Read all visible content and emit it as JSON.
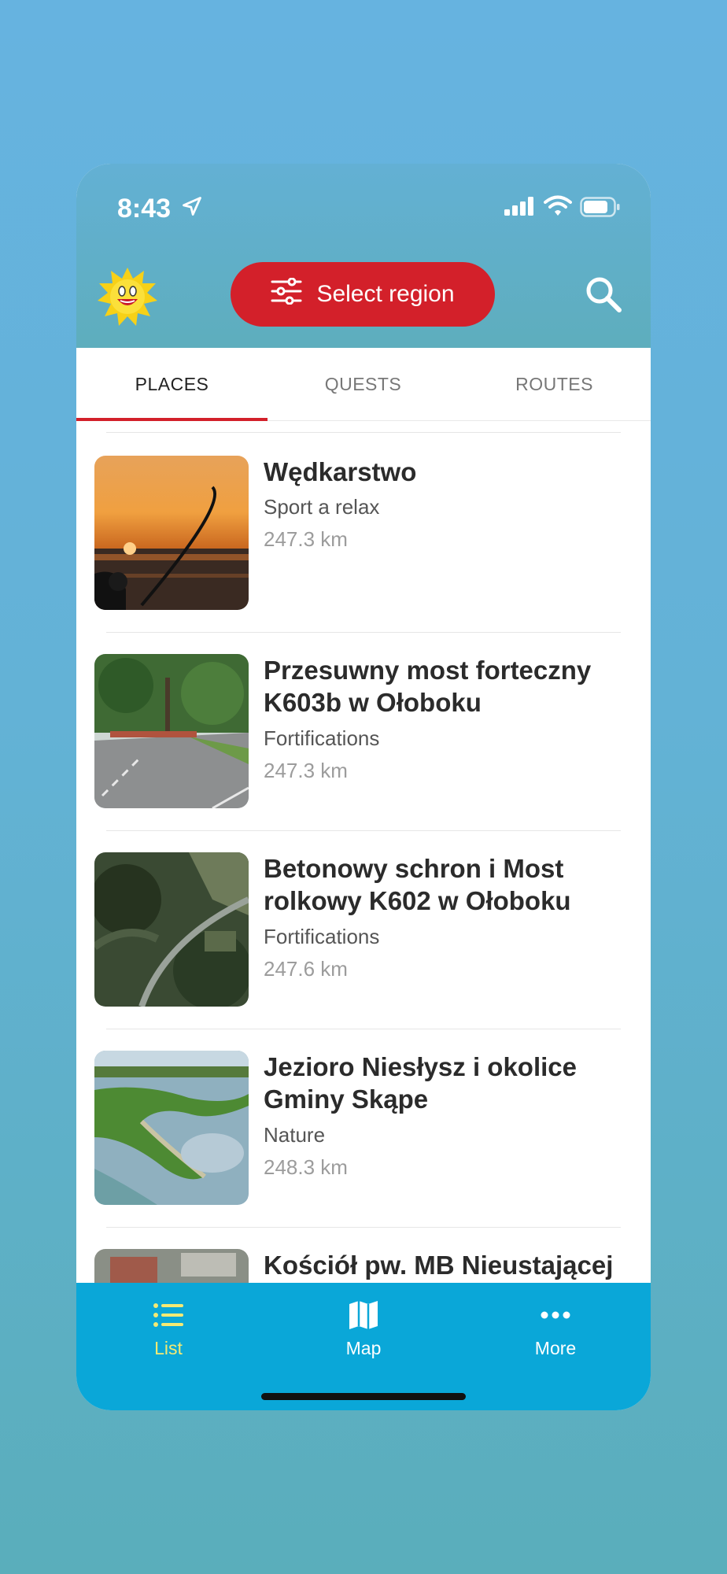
{
  "status_bar": {
    "time": "8:43"
  },
  "header": {
    "region_button_label": "Select region"
  },
  "tabs": [
    {
      "label": "PLACES",
      "active": true
    },
    {
      "label": "QUESTS",
      "active": false
    },
    {
      "label": "ROUTES",
      "active": false
    }
  ],
  "places": [
    {
      "title": "Wędkarstwo",
      "category": "Sport a relax",
      "distance": "247.3 km",
      "thumb_icon": "fishing-sunset-photo"
    },
    {
      "title": "Przesuwny most forteczny K603b w Ołoboku",
      "category": "Fortifications",
      "distance": "247.3 km",
      "thumb_icon": "road-bridge-photo"
    },
    {
      "title": "Betonowy schron i Most rolkowy K602 w Ołoboku",
      "category": "Fortifications",
      "distance": "247.6 km",
      "thumb_icon": "aerial-forest-photo"
    },
    {
      "title": "Jezioro Niesłysz i okolice Gminy Skąpe",
      "category": "Nature",
      "distance": "248.3 km",
      "thumb_icon": "aerial-lake-photo"
    },
    {
      "title": "Kościół pw. MB Nieustającej",
      "category": "",
      "distance": "",
      "thumb_icon": "aerial-church-photo"
    }
  ],
  "bottom_nav": [
    {
      "label": "List",
      "icon": "list-icon",
      "active": true
    },
    {
      "label": "Map",
      "icon": "map-icon",
      "active": false
    },
    {
      "label": "More",
      "icon": "more-icon",
      "active": false
    }
  ],
  "colors": {
    "accent_red": "#d3202a",
    "nav_blue": "#0aa7d8",
    "active_nav_yellow": "#f4ea74"
  }
}
